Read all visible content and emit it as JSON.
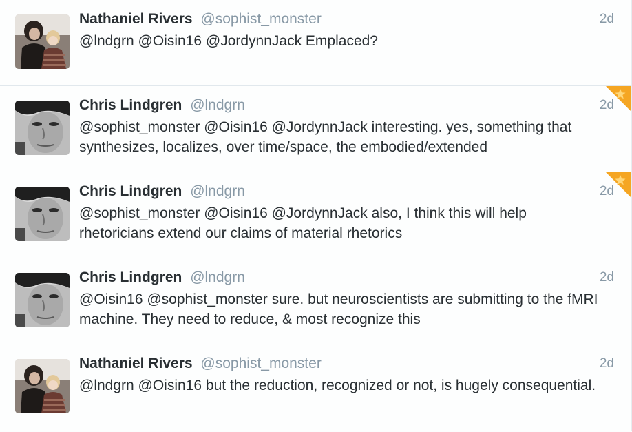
{
  "timeline": {
    "tweets": [
      {
        "fullname": "Nathaniel Rivers",
        "username": "@sophist_monster",
        "time": "2d",
        "text": "@lndgrn @Oisin16 @JordynnJack Emplaced?",
        "avatar": "nathaniel-rivers-photo",
        "favorited": false
      },
      {
        "fullname": "Chris Lindgren",
        "username": "@lndgrn",
        "time": "2d",
        "text": "@sophist_monster @Oisin16 @JordynnJack interesting. yes, something that synthesizes, localizes, over time/space, the embodied/extended",
        "avatar": "chris-lindgren-photo",
        "favorited": true
      },
      {
        "fullname": "Chris Lindgren",
        "username": "@lndgrn",
        "time": "2d",
        "text": "@sophist_monster @Oisin16 @JordynnJack also, I think this will help rhetoricians extend our claims of material rhetorics",
        "avatar": "chris-lindgren-photo",
        "favorited": true
      },
      {
        "fullname": "Chris Lindgren",
        "username": "@lndgrn",
        "time": "2d",
        "text": "@Oisin16 @sophist_monster sure. but neuroscientists are submitting to the fMRI machine. They need to reduce, & most recognize this",
        "avatar": "chris-lindgren-photo",
        "favorited": false
      },
      {
        "fullname": "Nathaniel Rivers",
        "username": "@sophist_monster",
        "time": "2d",
        "text": "@lndgrn @Oisin16 but the reduction, recognized or not, is hugely consequential.",
        "avatar": "nathaniel-rivers-photo",
        "favorited": false
      }
    ]
  },
  "colors": {
    "name": "#292f33",
    "muted": "#8899a6",
    "divider": "#e1e8ed",
    "favorite_badge": "#f5a623",
    "favorite_star": "#ffd77a"
  }
}
